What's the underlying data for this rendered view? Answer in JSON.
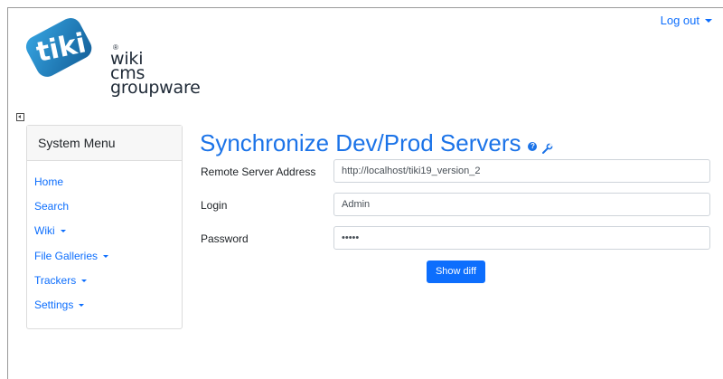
{
  "header": {
    "logo_badge": "tiki",
    "logo_reg": "®",
    "logo_lines": [
      "wiki",
      "cms",
      "groupware"
    ],
    "logout_label": "Log out"
  },
  "sidebar": {
    "title": "System Menu",
    "items": [
      {
        "label": "Home",
        "dropdown": false
      },
      {
        "label": "Search",
        "dropdown": false
      },
      {
        "label": "Wiki",
        "dropdown": true
      },
      {
        "label": "File Galleries",
        "dropdown": true
      },
      {
        "label": "Trackers",
        "dropdown": true
      },
      {
        "label": "Settings",
        "dropdown": true
      }
    ]
  },
  "main": {
    "title": "Synchronize Dev/Prod Servers",
    "help_icon": "help-icon",
    "edit_icon": "wrench-icon",
    "form": {
      "remote_label": "Remote Server Address",
      "remote_value": "http://localhost/tiki19_version_2",
      "login_label": "Login",
      "login_value": "Admin",
      "password_label": "Password",
      "password_value": "•••••",
      "submit_label": "Show diff"
    }
  },
  "colors": {
    "accent": "#0d6efd",
    "title": "#1b73e8",
    "logo_badge": "#1e86c8"
  }
}
